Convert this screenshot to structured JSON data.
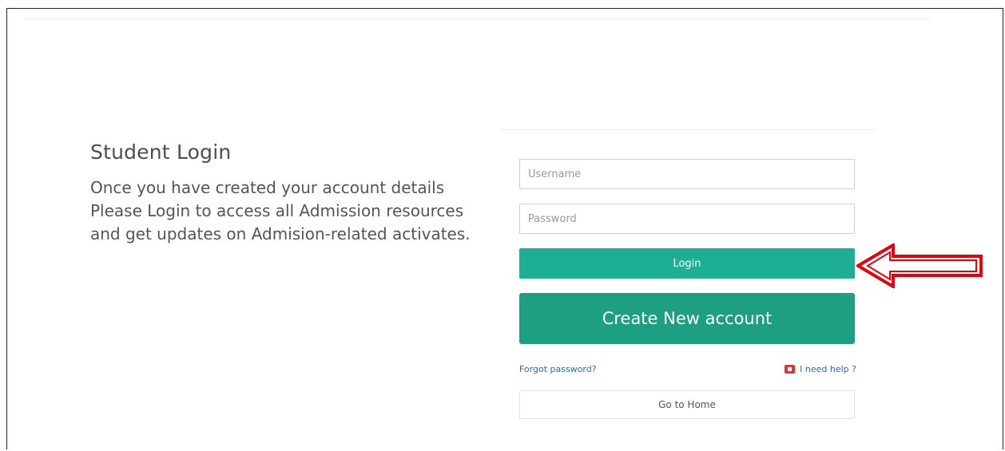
{
  "intro": {
    "title": "Student Login",
    "description": "Once you have created your account details Please Login to access all Admission resources and get updates on Admision-related activates."
  },
  "form": {
    "username_placeholder": "Username",
    "username_value": "",
    "password_placeholder": "Password",
    "password_value": "",
    "login_label": "Login",
    "create_label": "Create New account",
    "forgot_label": "Forgot password?",
    "help_label": "I need help ?",
    "home_label": "Go to Home"
  },
  "icons": {
    "help": "help-icon",
    "annotation": "red-arrow-icon"
  },
  "colors": {
    "login_button": "#1eae93",
    "create_button": "#1f9f82",
    "link": "#2d6da3",
    "arrow": "#e3000f"
  }
}
